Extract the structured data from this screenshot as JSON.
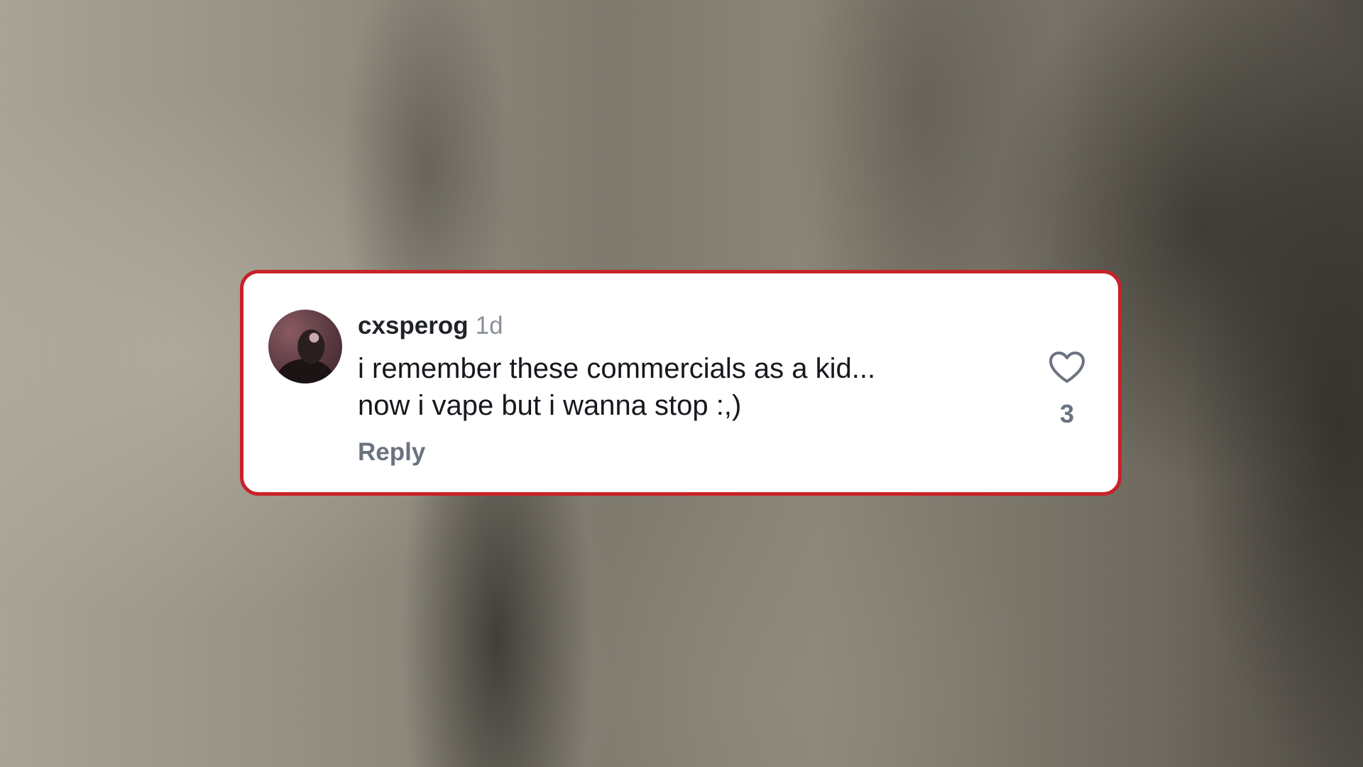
{
  "comment": {
    "username": "cxsperog",
    "timestamp": "1d",
    "text_lines": [
      "i remember these commercials as a kid...",
      "now i vape but i wanna stop :,)"
    ],
    "reply_label": "Reply",
    "like_count": "3",
    "like_icon": "heart-outline-icon"
  },
  "colors": {
    "card_border": "#c8222a",
    "card_background": "#ffffff",
    "username": "#202328",
    "muted_text": "#6b7280"
  }
}
